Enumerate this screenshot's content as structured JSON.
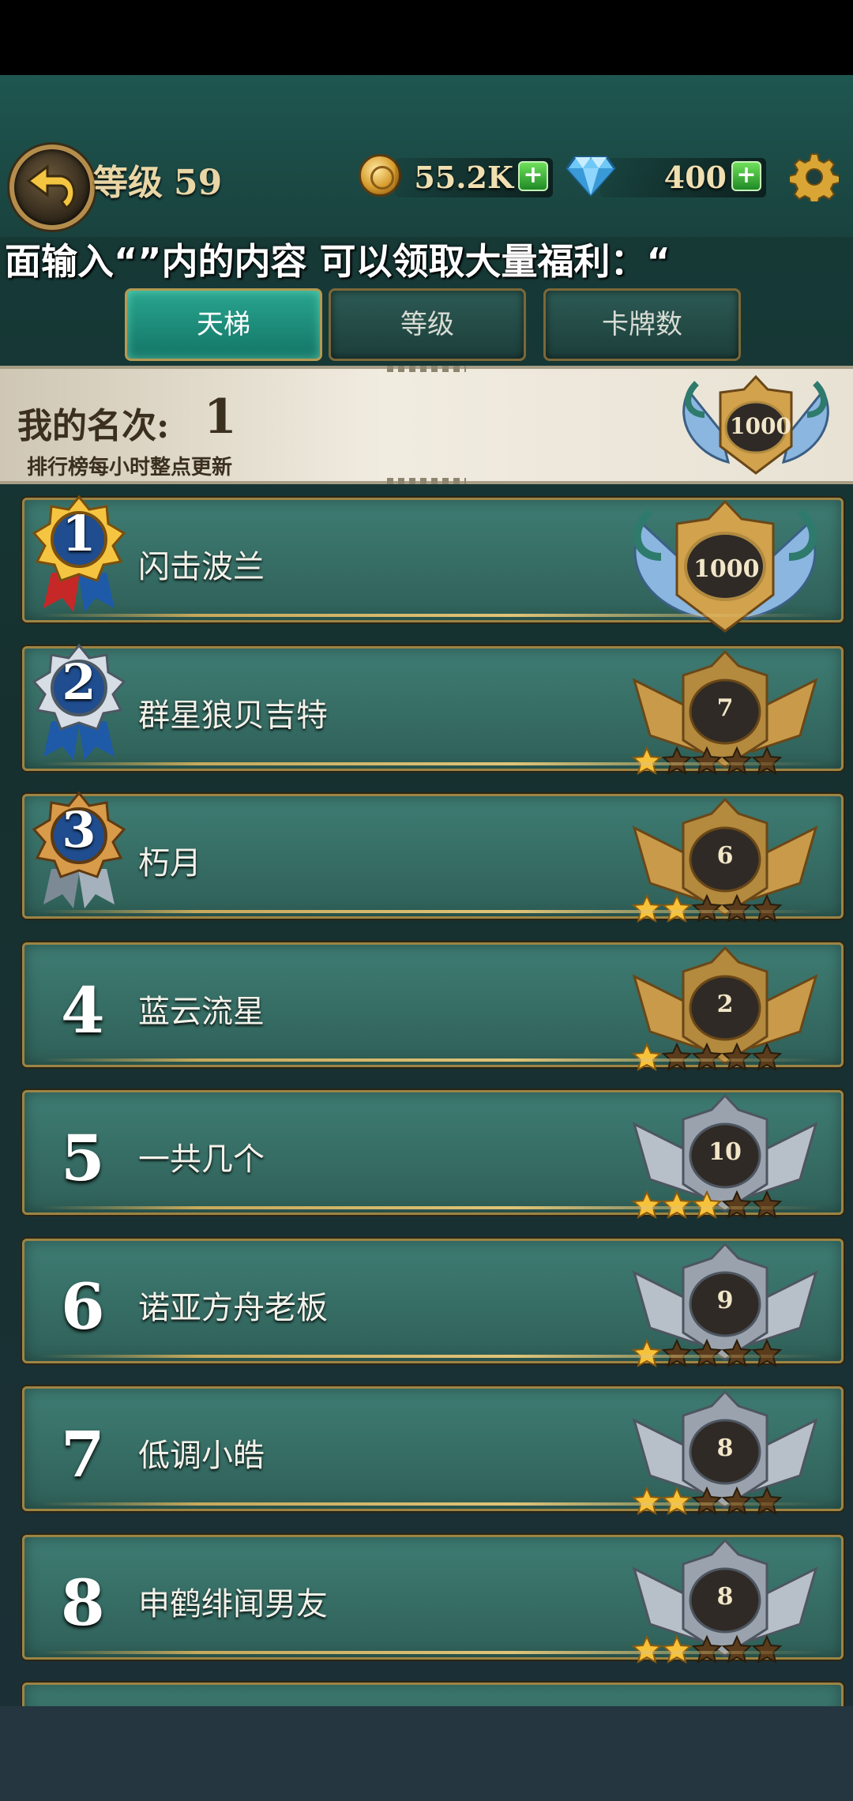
{
  "header": {
    "level_label": "等级",
    "level_value": "59",
    "coins": "55.2K",
    "diamonds": "400",
    "plus_symbol": "+"
  },
  "marquee": {
    "text": "面输入“”内的内容 可以领取大量福利：“"
  },
  "tabs": [
    {
      "label": "天梯",
      "active": true
    },
    {
      "label": "等级",
      "active": false
    },
    {
      "label": "卡牌数",
      "active": false
    }
  ],
  "my_rank": {
    "label": "我的名次:",
    "rank": "1",
    "note": "排行榜每小时整点更新",
    "badge_value": "1000"
  },
  "rows": [
    {
      "rank": "1",
      "name": "闪击波兰",
      "badge": "1000",
      "tier": "legend",
      "stars": 0
    },
    {
      "rank": "2",
      "name": "群星狼贝吉特",
      "badge": "7",
      "tier": "gold",
      "stars": 1
    },
    {
      "rank": "3",
      "name": "朽月",
      "badge": "6",
      "tier": "gold",
      "stars": 2
    },
    {
      "rank": "4",
      "name": "蓝云流星",
      "badge": "2",
      "tier": "gold",
      "stars": 1
    },
    {
      "rank": "5",
      "name": "一共几个",
      "badge": "10",
      "tier": "silver",
      "stars": 3
    },
    {
      "rank": "6",
      "name": "诺亚方舟老板",
      "badge": "9",
      "tier": "silver",
      "stars": 1
    },
    {
      "rank": "7",
      "name": "低调小皓",
      "badge": "8",
      "tier": "silver",
      "stars": 2
    },
    {
      "rank": "8",
      "name": "申鹤绯闻男友",
      "badge": "8",
      "tier": "silver",
      "stars": 2
    }
  ],
  "colors": {
    "accent_tab": "#29a58f",
    "row_bg": "#3e7c73",
    "gold_frame": "#9c8444"
  }
}
